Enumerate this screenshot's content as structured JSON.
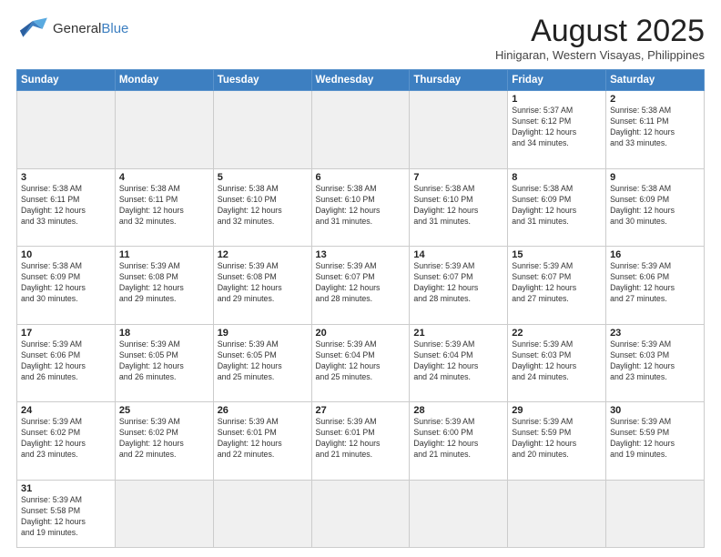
{
  "header": {
    "logo_general": "General",
    "logo_blue": "Blue",
    "month_year": "August 2025",
    "location": "Hinigaran, Western Visayas, Philippines"
  },
  "days_of_week": [
    "Sunday",
    "Monday",
    "Tuesday",
    "Wednesday",
    "Thursday",
    "Friday",
    "Saturday"
  ],
  "weeks": [
    [
      {
        "day": "",
        "info": "",
        "empty": true
      },
      {
        "day": "",
        "info": "",
        "empty": true
      },
      {
        "day": "",
        "info": "",
        "empty": true
      },
      {
        "day": "",
        "info": "",
        "empty": true
      },
      {
        "day": "",
        "info": "",
        "empty": true
      },
      {
        "day": "1",
        "info": "Sunrise: 5:37 AM\nSunset: 6:12 PM\nDaylight: 12 hours\nand 34 minutes."
      },
      {
        "day": "2",
        "info": "Sunrise: 5:38 AM\nSunset: 6:11 PM\nDaylight: 12 hours\nand 33 minutes."
      }
    ],
    [
      {
        "day": "3",
        "info": "Sunrise: 5:38 AM\nSunset: 6:11 PM\nDaylight: 12 hours\nand 33 minutes."
      },
      {
        "day": "4",
        "info": "Sunrise: 5:38 AM\nSunset: 6:11 PM\nDaylight: 12 hours\nand 32 minutes."
      },
      {
        "day": "5",
        "info": "Sunrise: 5:38 AM\nSunset: 6:10 PM\nDaylight: 12 hours\nand 32 minutes."
      },
      {
        "day": "6",
        "info": "Sunrise: 5:38 AM\nSunset: 6:10 PM\nDaylight: 12 hours\nand 31 minutes."
      },
      {
        "day": "7",
        "info": "Sunrise: 5:38 AM\nSunset: 6:10 PM\nDaylight: 12 hours\nand 31 minutes."
      },
      {
        "day": "8",
        "info": "Sunrise: 5:38 AM\nSunset: 6:09 PM\nDaylight: 12 hours\nand 31 minutes."
      },
      {
        "day": "9",
        "info": "Sunrise: 5:38 AM\nSunset: 6:09 PM\nDaylight: 12 hours\nand 30 minutes."
      }
    ],
    [
      {
        "day": "10",
        "info": "Sunrise: 5:38 AM\nSunset: 6:09 PM\nDaylight: 12 hours\nand 30 minutes."
      },
      {
        "day": "11",
        "info": "Sunrise: 5:39 AM\nSunset: 6:08 PM\nDaylight: 12 hours\nand 29 minutes."
      },
      {
        "day": "12",
        "info": "Sunrise: 5:39 AM\nSunset: 6:08 PM\nDaylight: 12 hours\nand 29 minutes."
      },
      {
        "day": "13",
        "info": "Sunrise: 5:39 AM\nSunset: 6:07 PM\nDaylight: 12 hours\nand 28 minutes."
      },
      {
        "day": "14",
        "info": "Sunrise: 5:39 AM\nSunset: 6:07 PM\nDaylight: 12 hours\nand 28 minutes."
      },
      {
        "day": "15",
        "info": "Sunrise: 5:39 AM\nSunset: 6:07 PM\nDaylight: 12 hours\nand 27 minutes."
      },
      {
        "day": "16",
        "info": "Sunrise: 5:39 AM\nSunset: 6:06 PM\nDaylight: 12 hours\nand 27 minutes."
      }
    ],
    [
      {
        "day": "17",
        "info": "Sunrise: 5:39 AM\nSunset: 6:06 PM\nDaylight: 12 hours\nand 26 minutes."
      },
      {
        "day": "18",
        "info": "Sunrise: 5:39 AM\nSunset: 6:05 PM\nDaylight: 12 hours\nand 26 minutes."
      },
      {
        "day": "19",
        "info": "Sunrise: 5:39 AM\nSunset: 6:05 PM\nDaylight: 12 hours\nand 25 minutes."
      },
      {
        "day": "20",
        "info": "Sunrise: 5:39 AM\nSunset: 6:04 PM\nDaylight: 12 hours\nand 25 minutes."
      },
      {
        "day": "21",
        "info": "Sunrise: 5:39 AM\nSunset: 6:04 PM\nDaylight: 12 hours\nand 24 minutes."
      },
      {
        "day": "22",
        "info": "Sunrise: 5:39 AM\nSunset: 6:03 PM\nDaylight: 12 hours\nand 24 minutes."
      },
      {
        "day": "23",
        "info": "Sunrise: 5:39 AM\nSunset: 6:03 PM\nDaylight: 12 hours\nand 23 minutes."
      }
    ],
    [
      {
        "day": "24",
        "info": "Sunrise: 5:39 AM\nSunset: 6:02 PM\nDaylight: 12 hours\nand 23 minutes."
      },
      {
        "day": "25",
        "info": "Sunrise: 5:39 AM\nSunset: 6:02 PM\nDaylight: 12 hours\nand 22 minutes."
      },
      {
        "day": "26",
        "info": "Sunrise: 5:39 AM\nSunset: 6:01 PM\nDaylight: 12 hours\nand 22 minutes."
      },
      {
        "day": "27",
        "info": "Sunrise: 5:39 AM\nSunset: 6:01 PM\nDaylight: 12 hours\nand 21 minutes."
      },
      {
        "day": "28",
        "info": "Sunrise: 5:39 AM\nSunset: 6:00 PM\nDaylight: 12 hours\nand 21 minutes."
      },
      {
        "day": "29",
        "info": "Sunrise: 5:39 AM\nSunset: 5:59 PM\nDaylight: 12 hours\nand 20 minutes."
      },
      {
        "day": "30",
        "info": "Sunrise: 5:39 AM\nSunset: 5:59 PM\nDaylight: 12 hours\nand 19 minutes."
      }
    ],
    [
      {
        "day": "31",
        "info": "Sunrise: 5:39 AM\nSunset: 5:58 PM\nDaylight: 12 hours\nand 19 minutes.",
        "last": true
      },
      {
        "day": "",
        "info": "",
        "empty": true,
        "last": true
      },
      {
        "day": "",
        "info": "",
        "empty": true,
        "last": true
      },
      {
        "day": "",
        "info": "",
        "empty": true,
        "last": true
      },
      {
        "day": "",
        "info": "",
        "empty": true,
        "last": true
      },
      {
        "day": "",
        "info": "",
        "empty": true,
        "last": true
      },
      {
        "day": "",
        "info": "",
        "empty": true,
        "last": true
      }
    ]
  ]
}
